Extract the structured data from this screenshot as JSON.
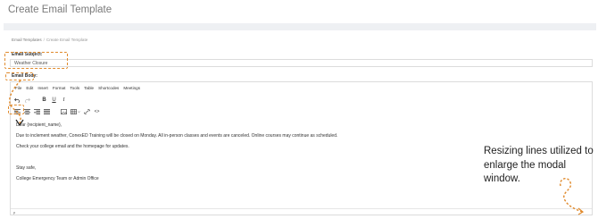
{
  "page": {
    "title": "Create Email Template"
  },
  "breadcrumb": {
    "items": [
      "Email Templates",
      "Create Email Template"
    ],
    "separator": "/"
  },
  "form": {
    "subject_label": "Email Subject:",
    "subject_value": "Weather Closure",
    "body_label": "Email Body:"
  },
  "editor": {
    "menu": [
      "File",
      "Edit",
      "Insert",
      "Format",
      "Tools",
      "Table",
      "Shortcodes",
      "Meetings"
    ],
    "toolbar": {
      "undo_icon": "undo-icon",
      "redo_icon": "redo-icon",
      "bold": "B",
      "underline": "U",
      "italic": "I",
      "align_left_icon": "align-left-icon",
      "align_center_icon": "align-center-icon",
      "align_right_icon": "align-right-icon",
      "justify_icon": "justify-icon",
      "image_icon": "image-icon",
      "table_icon": "table-icon",
      "link_icon": "link-icon",
      "code_icon": "code-icon",
      "code_glyph": "<>"
    },
    "content": {
      "greeting": "Dear {recipient_name},",
      "line1": "Due to inclement weather, ConexED Training  will be closed on Monday. All in-person classes and events are canceled. Online courses may continue as scheduled.",
      "line2": "Check your college email and the homepage for updates.",
      "closing": "Stay safe,",
      "signature": "College Emergency Team or Admin Office"
    },
    "statusbar": "p"
  },
  "annotation": {
    "text": "Resizing lines utilized to enlarge the modal window.",
    "color": "#e08a2c"
  }
}
